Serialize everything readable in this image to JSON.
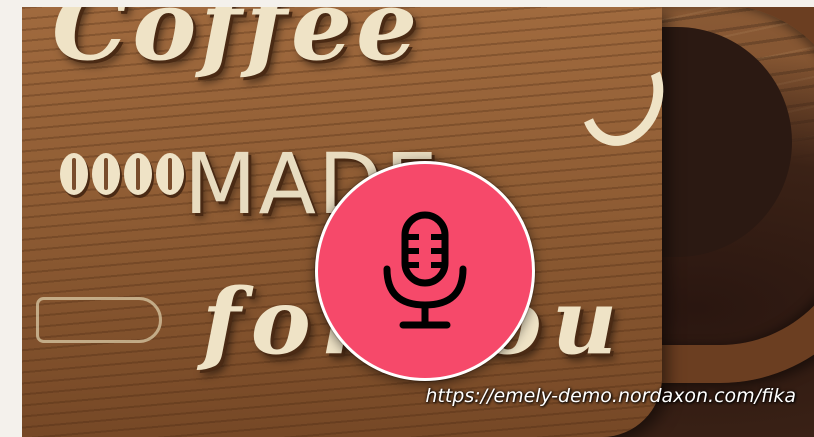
{
  "background_image": {
    "description_icon": "coffee-made-for-you-wood-sign",
    "texts": {
      "script_top": "Coffee",
      "made": "MADE",
      "for_you": "for you"
    }
  },
  "mic_button": {
    "icon": "microphone-icon",
    "color": "#f6496a",
    "border_color": "#ffffff"
  },
  "url_caption": "https://emely-demo.nordaxon.com/fika"
}
